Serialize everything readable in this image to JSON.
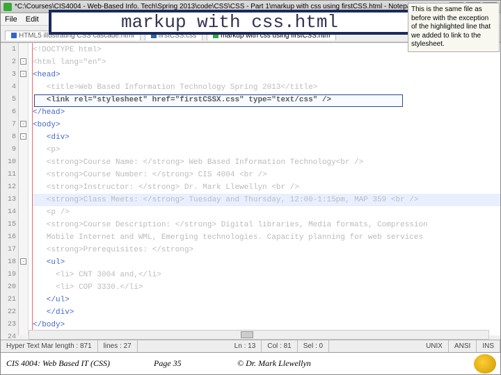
{
  "title": "*C:\\Courses\\CIS4004 - Web-Based Info. Tech\\Spring 2013\\code\\CSS\\CSS - Part 1\\markup with css using firstCSS.html - Notepa...",
  "menu": {
    "file": "File",
    "edit": "Edit"
  },
  "overlay_heading": "markup with css.html",
  "annotation": "This is the same file as before with the exception of the highlighted line that we added to link to the stylesheet.",
  "tabs": [
    {
      "label": "HTML5 illustrating CSS cascade.html"
    },
    {
      "label": "firstCSS.css"
    },
    {
      "label": "markup with css using firstCSS.htm"
    }
  ],
  "code": [
    "<!DOCTYPE html>",
    "<html lang=\"en\">",
    "<head>",
    "  <title>Web Based Information Technology Spring 2013</title>",
    "  <link rel=\"stylesheet\" href=\"firstCSSX.css\" type=\"text/css\"  />",
    "</head>",
    "<body>",
    "  <div>",
    "  <p>",
    "  <strong>Course Name: </strong> Web Based Information Technology<br />",
    "  <strong>Course Number: </strong> CIS 4004 <br />",
    "  <strong>Instructor: </strong> Dr. Mark Llewellyn <br />",
    "  <strong>Class Meets: </strong> Tuesday and Thursday, 12:00-1:15pm, MAP 359 <br />",
    "  <p />",
    "  <strong>Course Description: </strong> Digital libraries, Media formats, Compression",
    "  Mobile Internet and WML, Emerging technologies.  Capacity planning for web services",
    "  <strong>Prerequisites: </strong>",
    "  <ul>",
    "    <li> CNT 3004 and,</li>",
    "    <li> COP 3330.</li>",
    "  </ul>",
    "  </div>",
    "</body>",
    ""
  ],
  "status": {
    "hyper": "Hyper Text Mar length : 871",
    "lines": "lines : 27",
    "ln": "Ln : 13",
    "col": "Col : 81",
    "sel": "Sel : 0",
    "unix": "UNIX",
    "ansi": "ANSI",
    "ins": "INS"
  },
  "footer": {
    "left": "CIS 4004: Web Based IT (CSS)",
    "mid": "Page 35",
    "right": "© Dr. Mark Llewellyn"
  }
}
